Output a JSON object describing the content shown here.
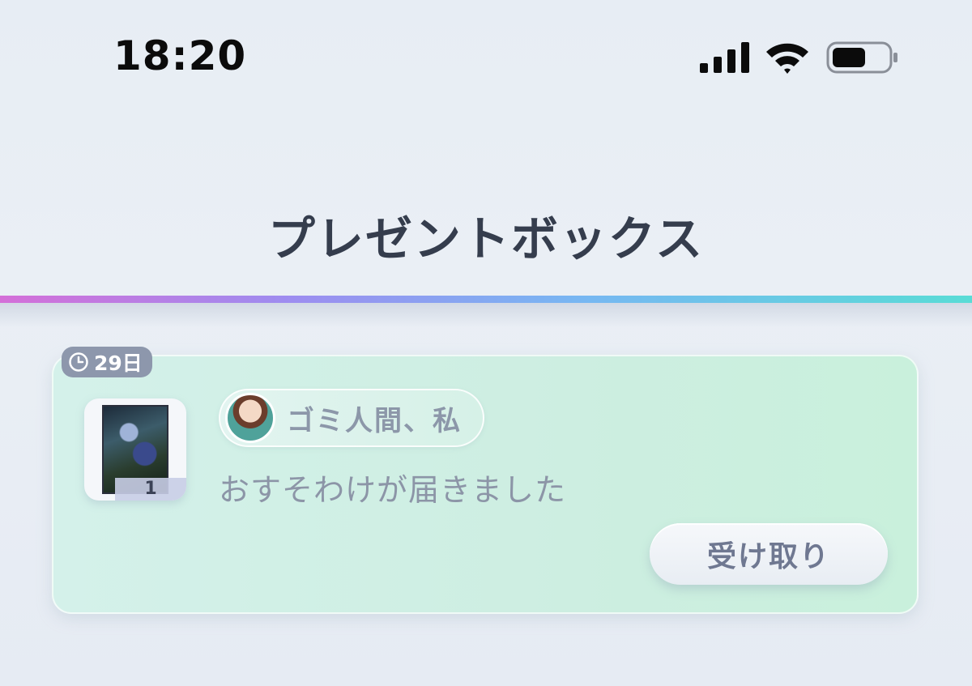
{
  "status_bar": {
    "time": "18:20",
    "icons": [
      "signal-icon",
      "wifi-icon",
      "battery-icon"
    ]
  },
  "header": {
    "title": "プレゼントボックス"
  },
  "gift_item": {
    "expiry_badge": "29日",
    "quantity": "1",
    "sender_name": "ゴミ人間、私",
    "message": "おすそわけが届きました",
    "receive_label": "受け取り"
  },
  "colors": {
    "title": "#353d4d",
    "card_bg": "#cdeee1",
    "badge_bg": "#8d97ac",
    "text_muted": "#8c95a7",
    "rainbow": [
      "#d46fd8",
      "#9d8df0",
      "#77b7f2",
      "#59dcd6"
    ]
  }
}
